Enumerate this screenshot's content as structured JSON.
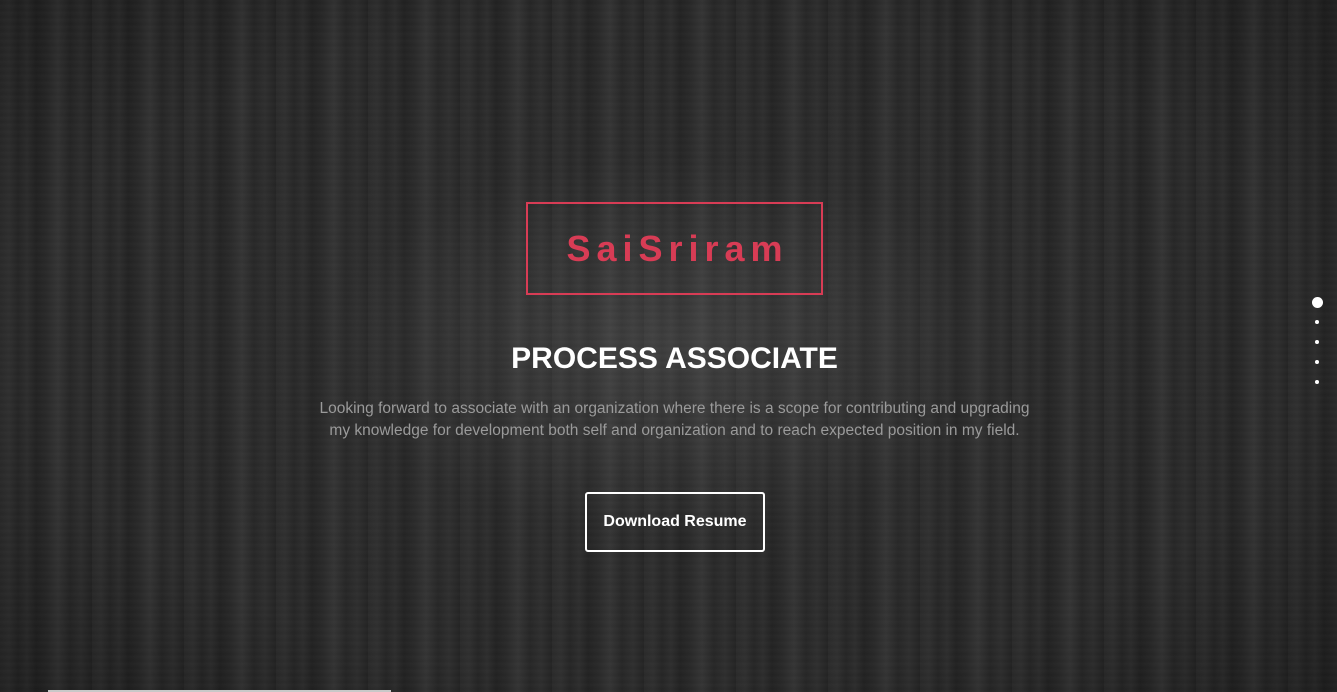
{
  "hero": {
    "name": "SaiSriram",
    "role": "PROCESS ASSOCIATE",
    "summary_line1": "Looking forward to associate with an organization where there is a scope for contributing and upgrading",
    "summary_line2": "my knowledge for development both self and organization and to reach expected position in my field.",
    "download_label": "Download Resume"
  },
  "section_nav": {
    "count": 5,
    "active_index": 0
  },
  "colors": {
    "accent": "#d83c55",
    "text_primary": "#ffffff",
    "text_muted": "#9a9a9a",
    "background": "#262626"
  }
}
